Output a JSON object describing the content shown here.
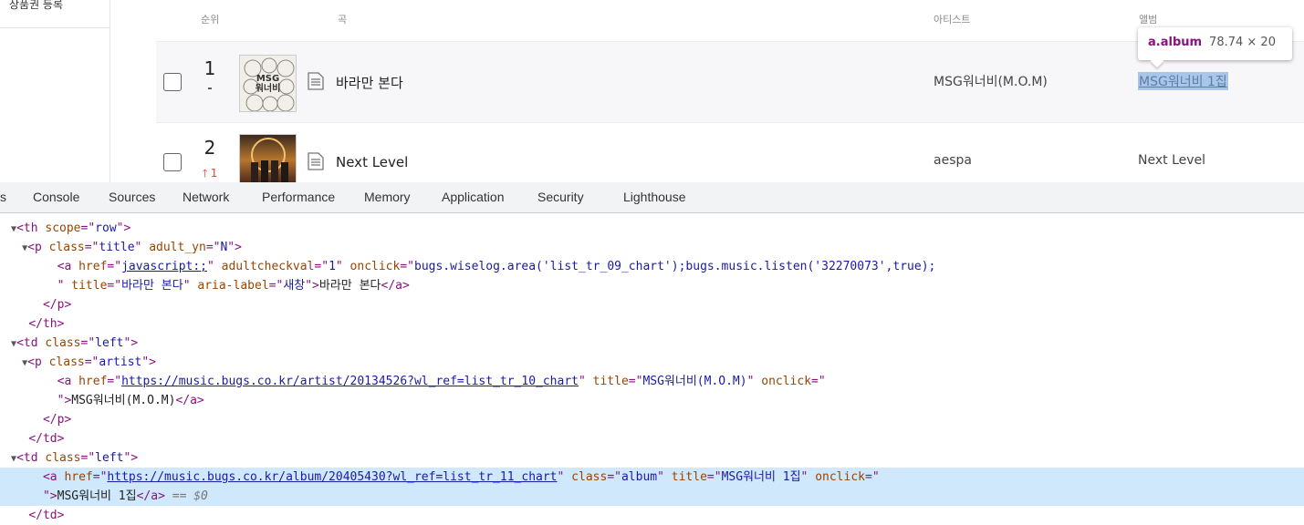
{
  "sidebar": {
    "item": "상품권 등록"
  },
  "chart": {
    "headers": {
      "rank": "순위",
      "song": "곡",
      "artist": "아티스트",
      "album": "앨범"
    },
    "rows": [
      {
        "rank": "1",
        "change": "-",
        "cover_text": "MSG\n워너비",
        "title": "바라만 본다",
        "artist": "MSG워너비(M.O.M)",
        "album": "MSG워너비 1집"
      },
      {
        "rank": "2",
        "change": "1",
        "change_direction": "up",
        "cover_text": "",
        "title": "Next Level",
        "artist": "aespa",
        "album": "Next Level"
      }
    ]
  },
  "tooltip": {
    "selector": "a.album",
    "size": "78.74 × 20"
  },
  "devtools": {
    "tabs": [
      "s",
      "Console",
      "Sources",
      "Network",
      "Performance",
      "Memory",
      "Application",
      "Security",
      "Lighthouse"
    ],
    "dom": {
      "l1_tag": "th",
      "l1_attr": "scope",
      "l1_val": "row",
      "l2_tag": "p",
      "l2_attr1": "class",
      "l2_val1": "title",
      "l2_attr2": "adult_yn",
      "l2_val2": "N",
      "l3_tag": "a",
      "l3_href_attr": "href",
      "l3_href": "javascript:;",
      "l3_attr2": "adultcheckval",
      "l3_val2": "1",
      "l3_attr3": "onclick",
      "l3_val3": "bugs.wiselog.area('list_tr_09_chart');bugs.music.listen('32270073',true);",
      "l4_attr1": "title",
      "l4_val1": "바라만 본다",
      "l4_attr2": "aria-label",
      "l4_val2": "새창",
      "l4_text": "바라만 본다",
      "l5_close": "p",
      "l6_close": "th",
      "l7_tag": "td",
      "l7_attr": "class",
      "l7_val": "left",
      "l8_tag": "p",
      "l8_attr": "class",
      "l8_val": "artist",
      "l9_tag": "a",
      "l9_href": "https://music.bugs.co.kr/artist/20134526?wl_ref=list_tr_10_chart",
      "l9_attr2": "title",
      "l9_val2": "MSG워너비(M.O.M)",
      "l9_attr3": "onclick",
      "l10_text": "MSG워너비(M.O.M)",
      "l11_close": "p",
      "l12_close": "td",
      "l13_tag": "td",
      "l13_attr": "class",
      "l13_val": "left",
      "l14_tag": "a",
      "l14_href": "https://music.bugs.co.kr/album/20405430?wl_ref=list_tr_11_chart",
      "l14_attr2": "class",
      "l14_val2": "album",
      "l14_attr3": "title",
      "l14_val3": "MSG워너비 1집",
      "l14_attr4": "onclick",
      "l15_text": "MSG워너비 1집",
      "l15_eq": "== $0",
      "l16_close": "td"
    }
  }
}
